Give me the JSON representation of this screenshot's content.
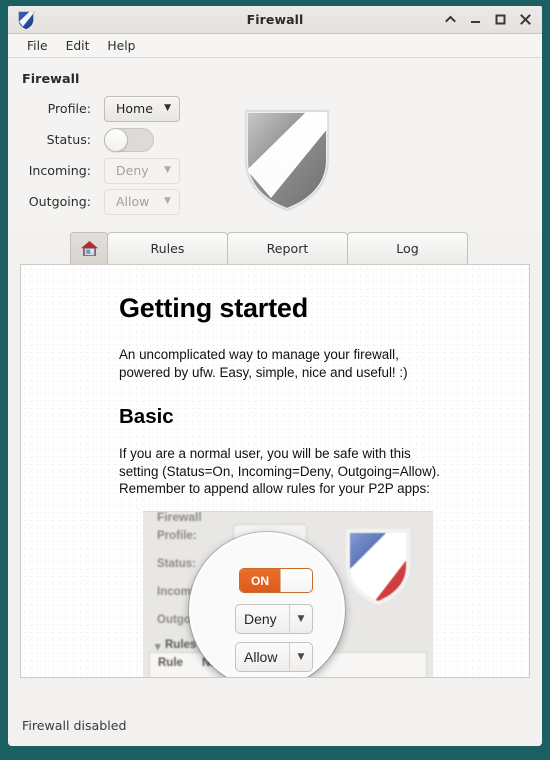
{
  "window": {
    "title": "Firewall",
    "app_icon": "shield-icon",
    "controls": [
      {
        "name": "shade-button",
        "glyph": "^"
      },
      {
        "name": "minimize-button",
        "glyph": "_"
      },
      {
        "name": "maximize-button",
        "glyph": "□"
      },
      {
        "name": "close-button",
        "glyph": "×"
      }
    ]
  },
  "menu": {
    "items": [
      "File",
      "Edit",
      "Help"
    ]
  },
  "settings": {
    "section_title": "Firewall",
    "profile": {
      "label": "Profile:",
      "value": "Home",
      "enabled": true
    },
    "status": {
      "label": "Status:",
      "value": "Off",
      "enabled": true
    },
    "incoming": {
      "label": "Incoming:",
      "value": "Deny",
      "enabled": false
    },
    "outgoing": {
      "label": "Outgoing:",
      "value": "Allow",
      "enabled": false
    },
    "shield_icon": "shield-icon-grey"
  },
  "tabs": [
    {
      "name": "tab-home",
      "label": "",
      "icon": "home-icon",
      "selected": true
    },
    {
      "name": "tab-rules",
      "label": "Rules",
      "selected": false
    },
    {
      "name": "tab-report",
      "label": "Report",
      "selected": false
    },
    {
      "name": "tab-log",
      "label": "Log",
      "selected": false
    }
  ],
  "content": {
    "heading": "Getting started",
    "intro": "An uncomplicated way to manage your firewall, powered by ufw. Easy, simple, nice and useful! :)",
    "subheading": "Basic",
    "body": "If you are a normal user, you will be safe with this setting (Status=On, Incoming=Deny, Outgoing=Allow). Remember to append allow rules for your P2P apps:",
    "illustration": {
      "background_labels": {
        "section": "Firewall",
        "profile": "Profile:",
        "status": "Status:",
        "incoming": "Incoming:",
        "outgoing": "Outgoing:",
        "rules_group": "Rules",
        "rules_expander": "▾",
        "table_headers": [
          "Rule",
          "Name"
        ]
      },
      "lens": {
        "toggle_on_label": "ON",
        "incoming_value": "Deny",
        "outgoing_value": "Allow",
        "caret": "▼"
      }
    }
  },
  "status_bar": {
    "text": "Firewall disabled"
  },
  "colors": {
    "window_frame": "#1c5f63",
    "accent_orange": "#ec6e2a",
    "panel_bg": "#f4f3f1",
    "content_bg": "#ffffff"
  }
}
